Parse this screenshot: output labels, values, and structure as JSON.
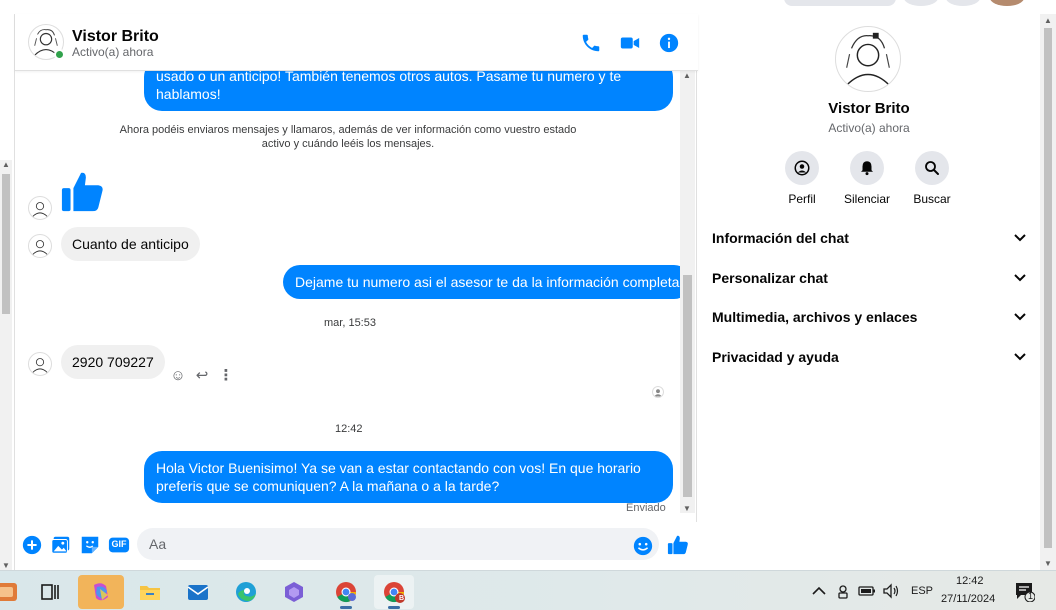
{
  "contact": {
    "name": "Vistor Brito",
    "status": "Activo(a) ahora"
  },
  "messages": {
    "top_partial": "usado o un anticipo! También tenemos otros autos. Pasame tu numero y te hablamos!",
    "system_note": "Ahora podéis enviaros mensajes y llamaros, además de ver información como vuestro estado activo y cuándo leéis los mensajes.",
    "incoming_1": "Cuanto de anticipo",
    "outgoing_1": "Dejame tu numero asi el asesor te da la información completa",
    "timestamp_1": "mar, 15:53",
    "incoming_2": "2920 709227",
    "timestamp_2": "12:42",
    "outgoing_2": "Hola Victor Buenisimo! Ya se van a estar contactando con vos! En que horario preferis que se comuniquen? A la mañana o a la tarde?",
    "sent_status": "Enviado"
  },
  "composer": {
    "placeholder": "Aa",
    "gif_label": "GIF"
  },
  "info_panel": {
    "actions": [
      {
        "label": "Perfil",
        "icon": "profile-icon"
      },
      {
        "label": "Silenciar",
        "icon": "bell-icon"
      },
      {
        "label": "Buscar",
        "icon": "search-icon"
      }
    ],
    "sections": [
      "Información del chat",
      "Personalizar chat",
      "Multimedia, archivos y enlaces",
      "Privacidad y ayuda"
    ]
  },
  "taskbar": {
    "language": "ESP",
    "time": "12:42",
    "date": "27/11/2024",
    "notification_count": "1",
    "chrome_badge": "B"
  },
  "colors": {
    "messenger_blue": "#0084ff",
    "incoming_bubble": "#f0f0f0",
    "online_green": "#31a24c"
  }
}
